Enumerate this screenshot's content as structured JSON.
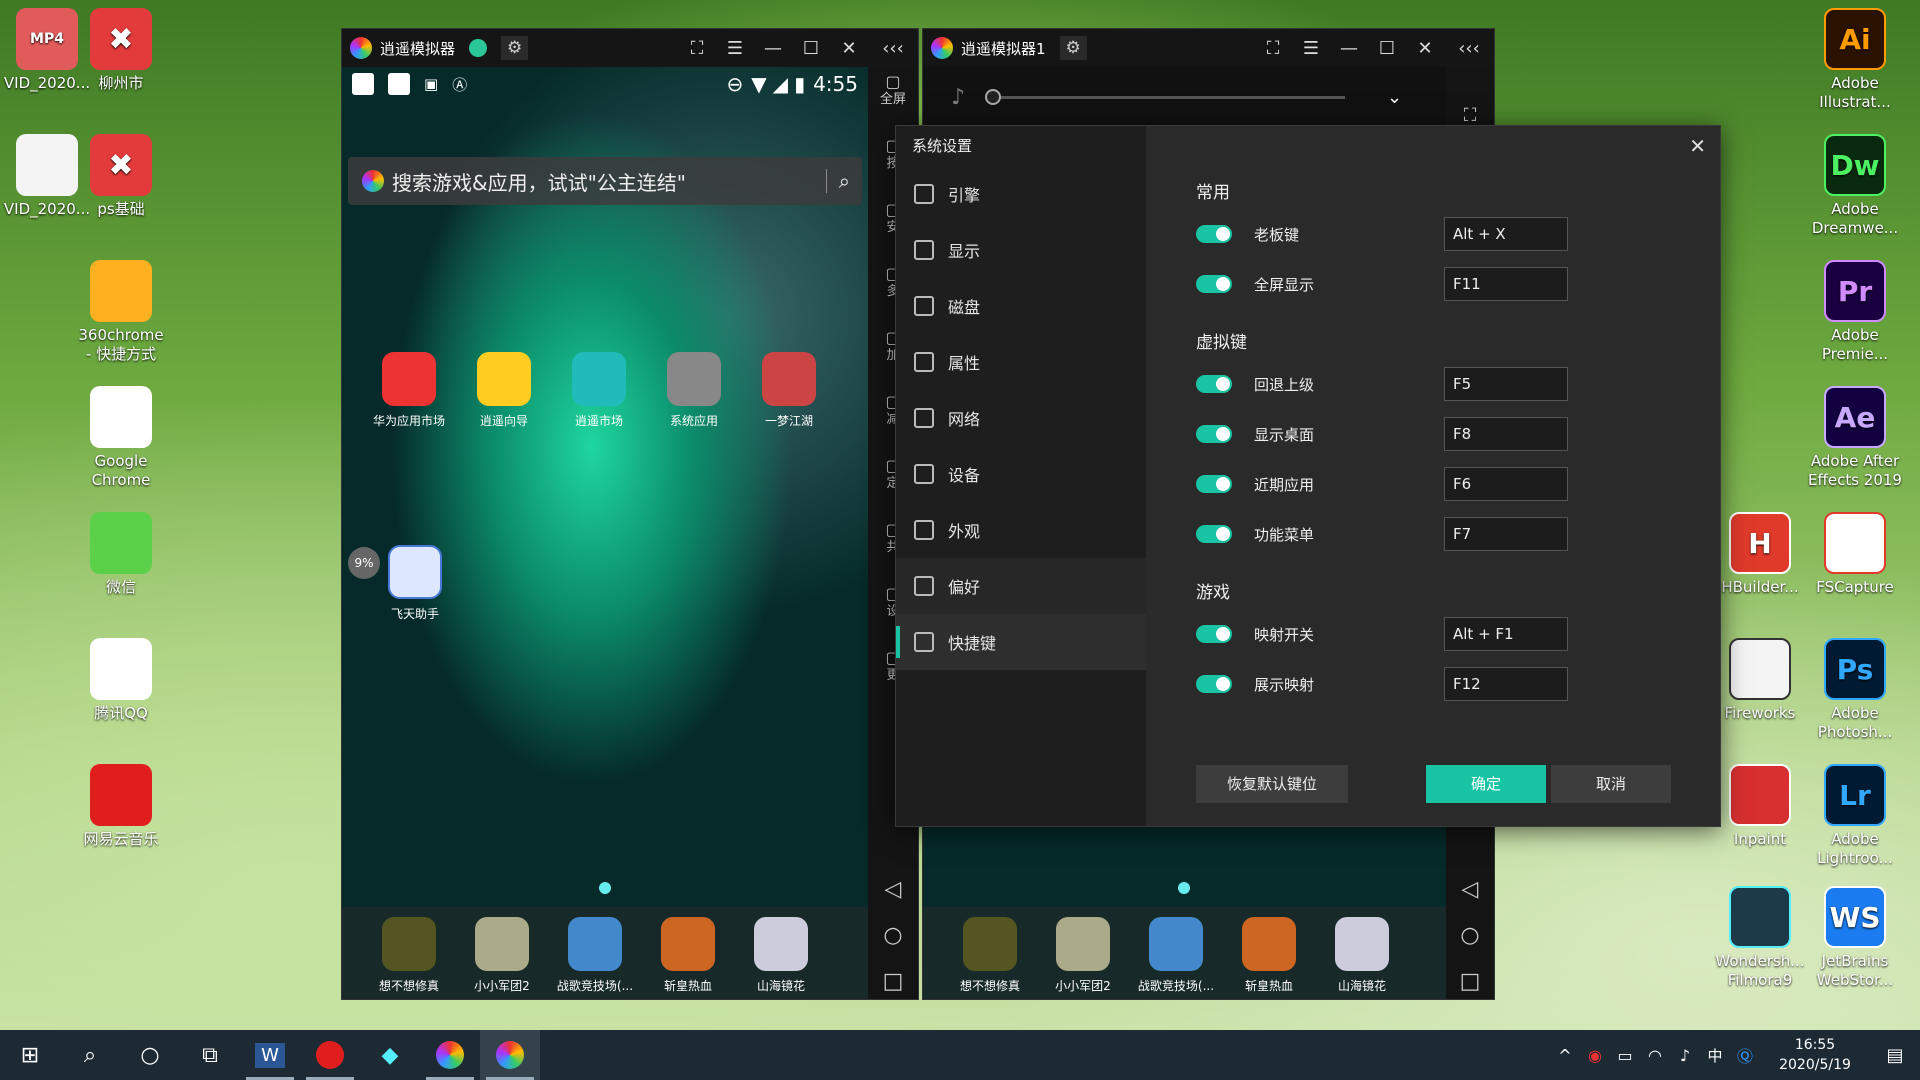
{
  "desktop_left": [
    {
      "label": "VID_2020...",
      "badge": "MP4",
      "color": "#e25b5b"
    },
    {
      "label": "柳州市",
      "badge": "✖",
      "color": "#e33b3b"
    },
    {
      "label": "VID_2020...",
      "badge": "",
      "color": "#f4f4f4"
    },
    {
      "label": "ps基础",
      "badge": "✖",
      "color": "#e33b3b"
    },
    {
      "label": "360chrome\n- 快捷方式",
      "badge": "",
      "color": "#ffb020"
    },
    {
      "label": "Google\nChrome",
      "badge": "",
      "color": "#ffffff"
    },
    {
      "label": "微信",
      "badge": "",
      "color": "#5bd14a"
    },
    {
      "label": "腾讯QQ",
      "badge": "",
      "color": "#ffffff"
    },
    {
      "label": "网易云音乐",
      "badge": "",
      "color": "#e01e1e"
    }
  ],
  "desktop_right": [
    {
      "label": "Adobe\nIllustrat...",
      "badge": "Ai",
      "color": "#2a1200",
      "fg": "#ff9a00"
    },
    {
      "label": "Adobe\nDreamwe...",
      "badge": "Dw",
      "color": "#0a2a10",
      "fg": "#4cf060"
    },
    {
      "label": "Adobe\nPremie...",
      "badge": "Pr",
      "color": "#1a0040",
      "fg": "#d08cff"
    },
    {
      "label": "Adobe After\nEffects 2019",
      "badge": "Ae",
      "color": "#120040",
      "fg": "#c8a8ff"
    },
    {
      "label": "HBuilder...",
      "badge": "H",
      "color": "#e03a2a",
      "fg": "#ffffff"
    },
    {
      "label": "FSCapture",
      "badge": "",
      "color": "#ffffff",
      "fg": "#e03a2a"
    },
    {
      "label": "Fireworks",
      "badge": "",
      "color": "#f4f4f4",
      "fg": "#333"
    },
    {
      "label": "Adobe\nPhotosh...",
      "badge": "Ps",
      "color": "#001a33",
      "fg": "#31a8ff"
    },
    {
      "label": "Inpaint",
      "badge": "",
      "color": "#d83030",
      "fg": "#fff"
    },
    {
      "label": "Adobe\nLightroo...",
      "badge": "Lr",
      "color": "#001a33",
      "fg": "#31a8ff"
    },
    {
      "label": "Wondersh...\nFilmora9",
      "badge": "",
      "color": "#1c3a48",
      "fg": "#5ef"
    },
    {
      "label": "JetBrains\nWebStor...",
      "badge": "WS",
      "color": "#1a7cf0",
      "fg": "#fff"
    }
  ],
  "emu1": {
    "title": "逍遥模拟器",
    "status_time": "4:55",
    "search_placeholder": "搜索游戏&应用，试试\"公主连结\"",
    "apps": [
      "华为应用市场",
      "逍遥向导",
      "逍遥市场",
      "系统应用",
      "一梦江湖"
    ],
    "app2": "飞天助手",
    "progress": "9%",
    "dock": [
      "想不想修真",
      "小小军团2",
      "战歌竞技场(...",
      "斩皇热血",
      "山海镜花"
    ],
    "side": [
      "全屏",
      "按",
      "安",
      "多",
      "加",
      "减",
      "定",
      "共",
      "设",
      "更"
    ]
  },
  "emu2": {
    "title": "逍遥模拟器1",
    "dock": [
      "想不想修真",
      "小小军团2",
      "战歌竞技场(...",
      "斩皇热血",
      "山海镜花"
    ]
  },
  "dialog": {
    "title": "系统设置",
    "nav": [
      "引擎",
      "显示",
      "磁盘",
      "属性",
      "网络",
      "设备",
      "外观",
      "偏好",
      "快捷键"
    ],
    "sections": [
      {
        "label": "常用",
        "rows": [
          {
            "name": "老板键",
            "key": "Alt + X"
          },
          {
            "name": "全屏显示",
            "key": "F11"
          }
        ]
      },
      {
        "label": "虚拟键",
        "rows": [
          {
            "name": "回退上级",
            "key": "F5"
          },
          {
            "name": "显示桌面",
            "key": "F8"
          },
          {
            "name": "近期应用",
            "key": "F6"
          },
          {
            "name": "功能菜单",
            "key": "F7"
          }
        ]
      },
      {
        "label": "游戏",
        "rows": [
          {
            "name": "映射开关",
            "key": "Alt + F1"
          },
          {
            "name": "展示映射",
            "key": "F12"
          }
        ]
      }
    ],
    "restore_label": "恢复默认键位",
    "ok_label": "确定",
    "cancel_label": "取消",
    "close": "✕"
  },
  "taskbar": {
    "time": "16:55",
    "date": "2020/5/19",
    "ime": "中"
  },
  "colors": {
    "accent": "#18c4a4"
  }
}
